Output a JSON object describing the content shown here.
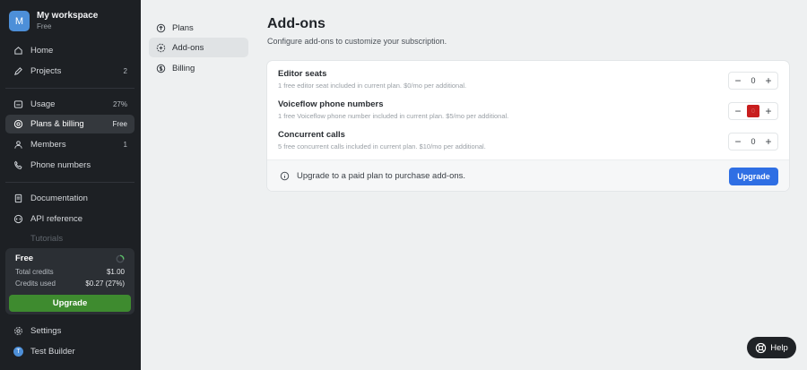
{
  "workspace": {
    "initial": "M",
    "name": "My workspace",
    "plan": "Free"
  },
  "sidebar": {
    "items": [
      {
        "label": "Home",
        "icon": "home-icon",
        "badge": ""
      },
      {
        "label": "Projects",
        "icon": "pencil-icon",
        "badge": "2"
      },
      {
        "label": "Usage",
        "icon": "usage-icon",
        "badge": "27%"
      },
      {
        "label": "Plans & billing",
        "icon": "billing-icon",
        "badge": "Free",
        "active": true
      },
      {
        "label": "Members",
        "icon": "members-icon",
        "badge": "1"
      },
      {
        "label": "Phone numbers",
        "icon": "phone-icon",
        "badge": ""
      },
      {
        "label": "Documentation",
        "icon": "document-icon",
        "badge": ""
      },
      {
        "label": "API reference",
        "icon": "api-icon",
        "badge": ""
      },
      {
        "label": "Tutorials",
        "icon": "tutorials-icon",
        "badge": ""
      }
    ],
    "credits": {
      "plan": "Free",
      "total_label": "Total credits",
      "total_value": "$1.00",
      "used_label": "Credits used",
      "used_value": "$0.27 (27%)",
      "used_fraction": 0.27,
      "upgrade_label": "Upgrade"
    },
    "settings_label": "Settings",
    "user": {
      "initial": "T",
      "name": "Test Builder"
    }
  },
  "subnav": {
    "items": [
      {
        "label": "Plans",
        "icon": "arrow-up-circle-icon"
      },
      {
        "label": "Add-ons",
        "icon": "add-on-icon",
        "active": true
      },
      {
        "label": "Billing",
        "icon": "dollar-circle-icon"
      }
    ]
  },
  "main": {
    "title": "Add-ons",
    "subtitle": "Configure add-ons to customize your subscription.",
    "addons": [
      {
        "name": "Editor seats",
        "desc": "1 free editor seat included in current plan. $0/mo per additional.",
        "value": "0"
      },
      {
        "name": "Voiceflow phone numbers",
        "desc": "1 free Voiceflow phone number included in current plan. $5/mo per additional.",
        "value": "0"
      },
      {
        "name": "Concurrent calls",
        "desc": "5 free concurrent calls included in current plan. $10/mo per additional.",
        "value": "0"
      }
    ],
    "notice": "Upgrade to a paid plan to purchase add-ons.",
    "upgrade_label": "Upgrade"
  },
  "help_label": "Help",
  "colors": {
    "sidebar_bg": "#1d2024",
    "accent_blue": "#2f6fe4",
    "upgrade_green": "#3e8b2f",
    "highlight_red": "#c81e1e"
  }
}
